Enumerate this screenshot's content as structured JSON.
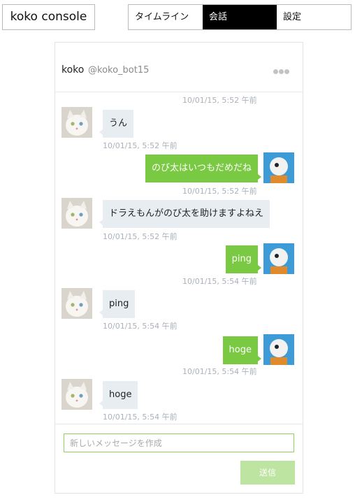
{
  "app": {
    "title": "koko console"
  },
  "nav": {
    "tabs": [
      {
        "label": "タイムライン"
      },
      {
        "label": "会話"
      },
      {
        "label": "設定"
      }
    ],
    "active": 1
  },
  "conversation": {
    "name": "koko",
    "handle": "@koko_bot15",
    "more_icon": "more-dots-icon",
    "top_timestamp": "10/01/15, 5:52 午前",
    "messages": [
      {
        "dir": "in",
        "text": "うん",
        "time": "10/01/15, 5:52 午前",
        "avatar": "cat-avatar-icon"
      },
      {
        "dir": "out",
        "text": "のび太はいつもだめだね",
        "time": "10/01/15, 5:52 午前",
        "avatar": "cartoon-avatar-icon"
      },
      {
        "dir": "in",
        "text": "ドラえもんがのび太を助けますよねえ",
        "time": "10/01/15, 5:52 午前",
        "avatar": "cat-avatar-icon"
      },
      {
        "dir": "out",
        "text": "ping",
        "time": "10/01/15, 5:54 午前",
        "avatar": "cartoon-avatar-icon"
      },
      {
        "dir": "in",
        "text": "ping",
        "time": "10/01/15, 5:54 午前",
        "avatar": "cat-avatar-icon"
      },
      {
        "dir": "out",
        "text": "hoge",
        "time": "10/01/15, 5:54 午前",
        "avatar": "cartoon-avatar-icon"
      },
      {
        "dir": "in",
        "text": "hoge",
        "time": "10/01/15, 5:54 午前",
        "avatar": "cat-avatar-icon"
      }
    ]
  },
  "composer": {
    "placeholder": "新しいメッセージを作成",
    "value": "",
    "send_label": "送信"
  },
  "colors": {
    "outgoing_bubble": "#7ac943",
    "incoming_bubble": "#e8edf2",
    "active_tab": "#000000",
    "send_button": "#bde4a0"
  }
}
